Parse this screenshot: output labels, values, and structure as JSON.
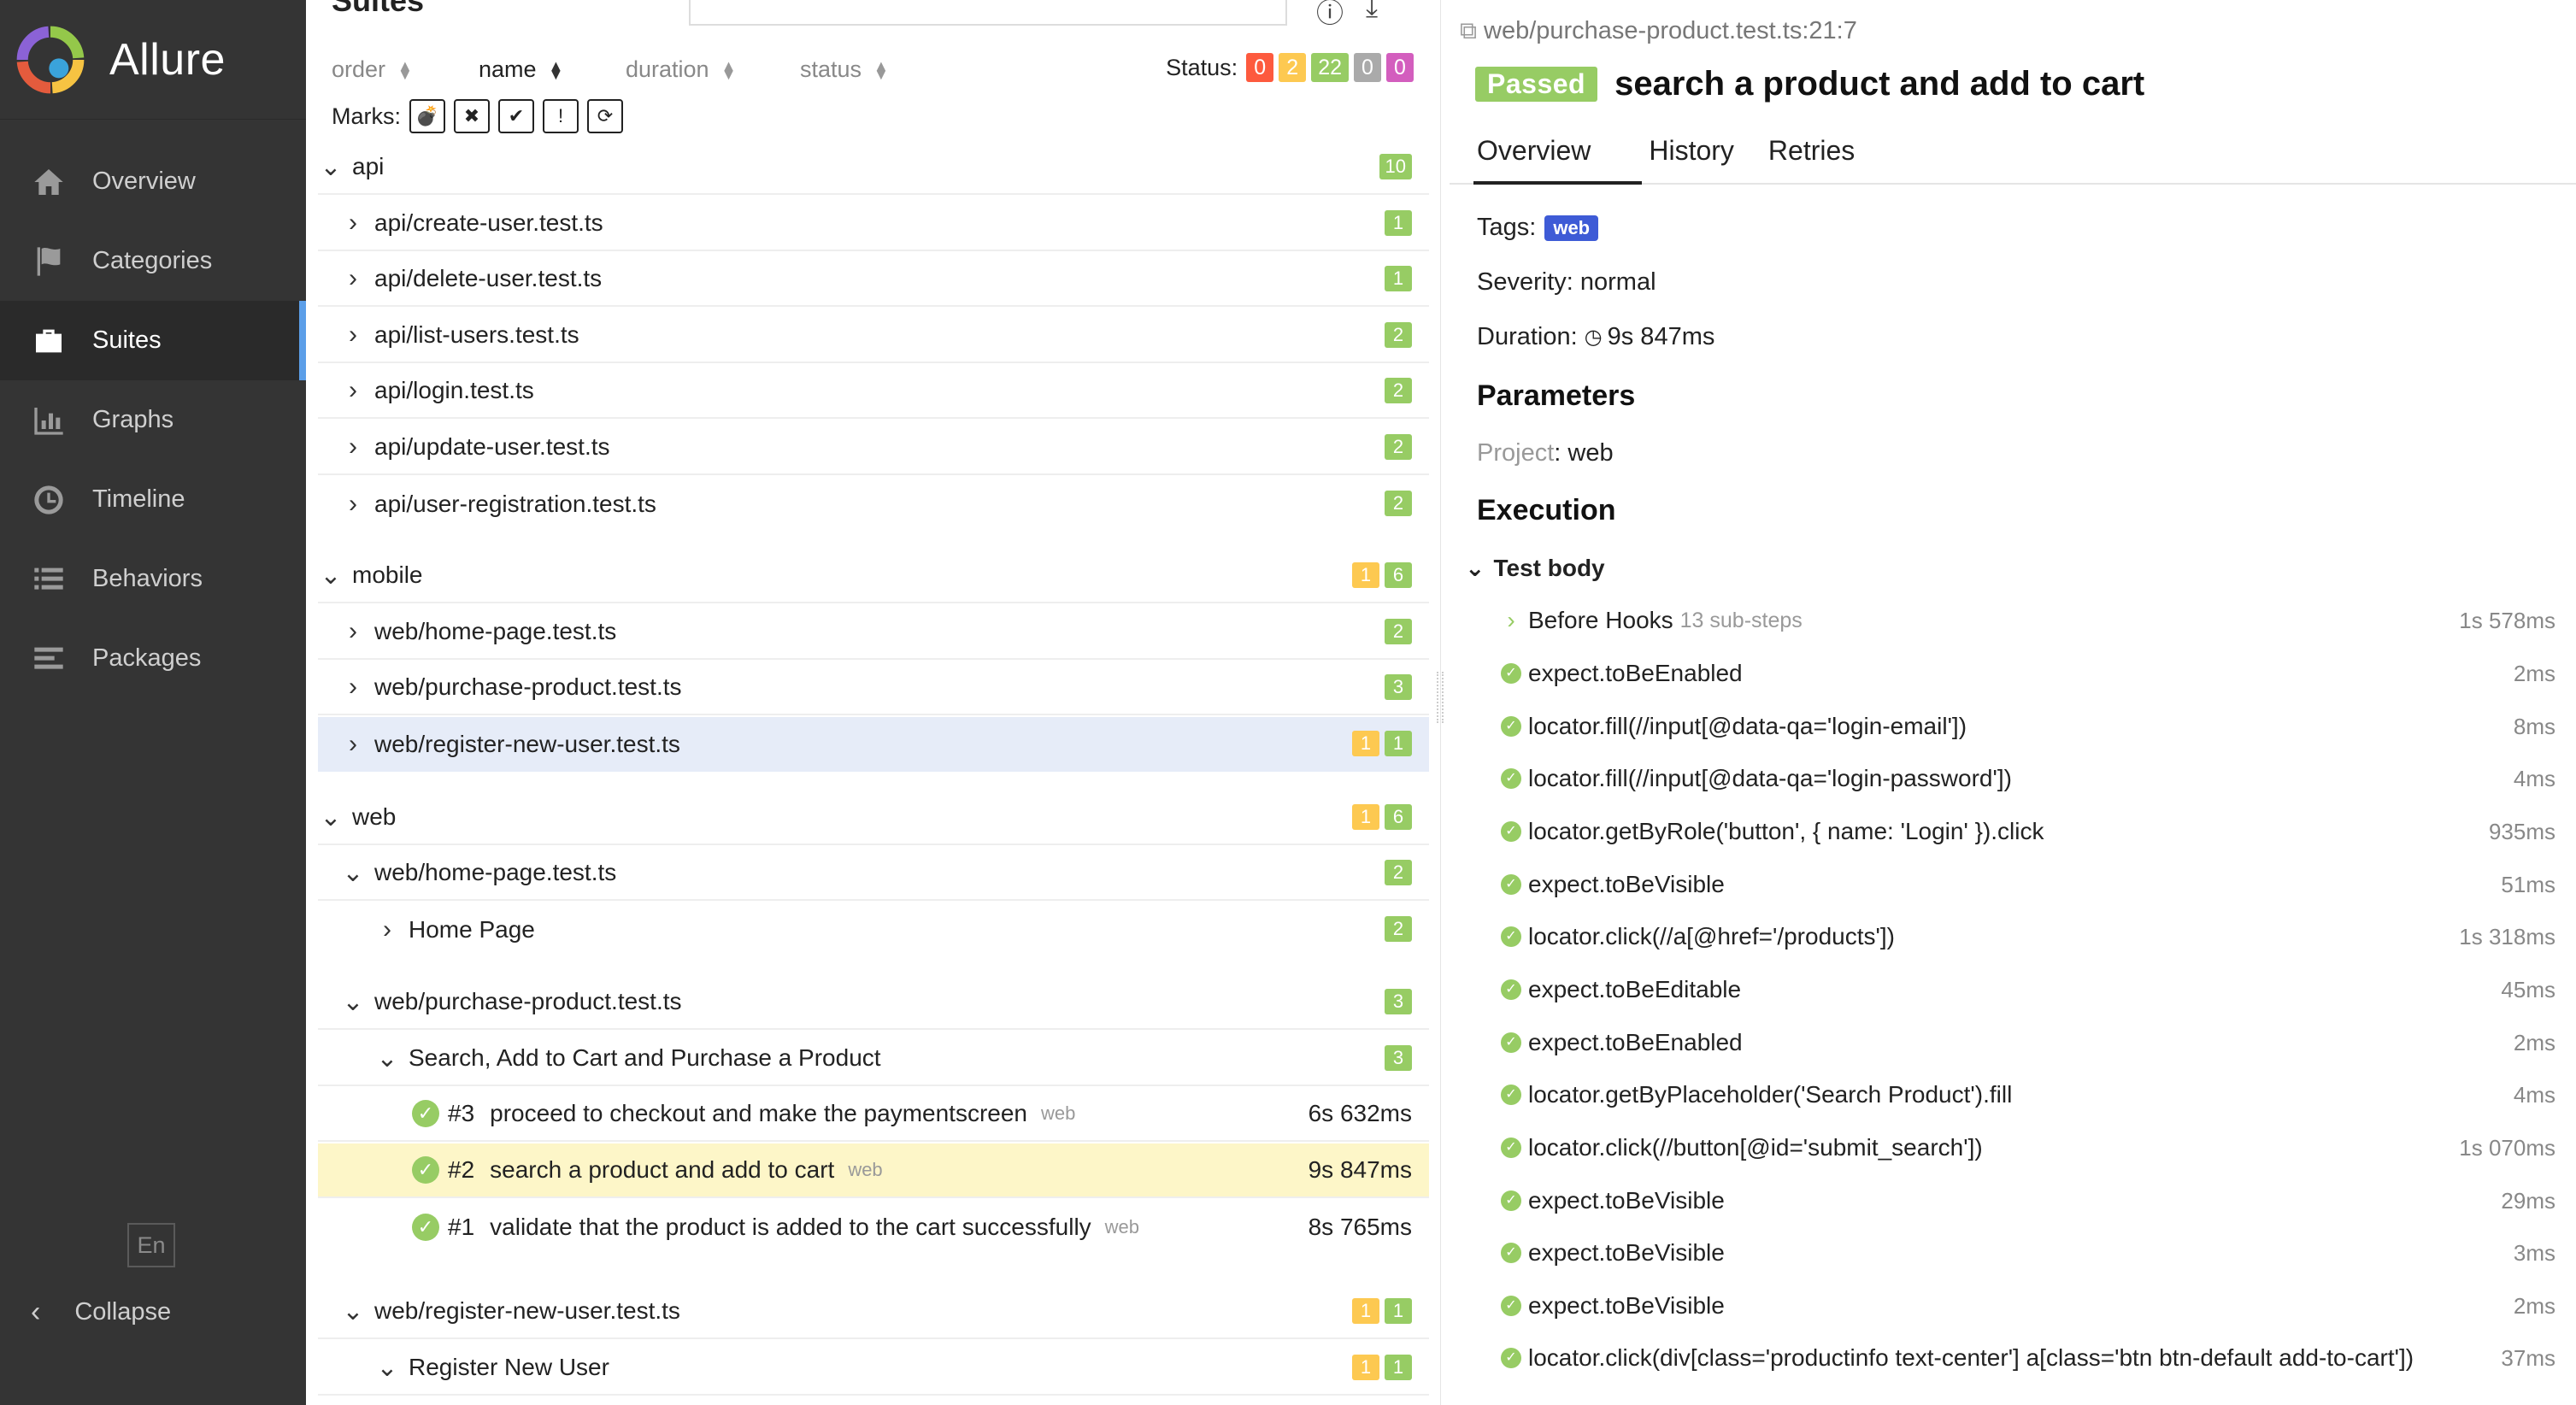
{
  "app": {
    "brand": "Allure",
    "language": "En",
    "collapse_label": "Collapse"
  },
  "sidebar": {
    "items": [
      {
        "label": "Overview",
        "icon": "home-icon"
      },
      {
        "label": "Categories",
        "icon": "flag-icon"
      },
      {
        "label": "Suites",
        "icon": "briefcase-icon",
        "active": true
      },
      {
        "label": "Graphs",
        "icon": "bar-chart-icon"
      },
      {
        "label": "Timeline",
        "icon": "clock-icon"
      },
      {
        "label": "Behaviors",
        "icon": "list-icon"
      },
      {
        "label": "Packages",
        "icon": "align-left-icon"
      }
    ]
  },
  "suites": {
    "heading": "Suites",
    "sort": {
      "order": "order",
      "name": "name",
      "duration": "duration",
      "status": "status"
    },
    "status_label": "Status:",
    "status_counts": {
      "failed": "0",
      "broken": "2",
      "passed": "22",
      "skipped": "0",
      "unknown": "0"
    },
    "marks_label": "Marks:",
    "tree": {
      "api": {
        "label": "api",
        "count": "10"
      },
      "api_items": [
        {
          "label": "api/create-user.test.ts",
          "count": "1"
        },
        {
          "label": "api/delete-user.test.ts",
          "count": "1"
        },
        {
          "label": "api/list-users.test.ts",
          "count": "2"
        },
        {
          "label": "api/login.test.ts",
          "count": "2"
        },
        {
          "label": "api/update-user.test.ts",
          "count": "2"
        },
        {
          "label": "api/user-registration.test.ts",
          "count": "2"
        }
      ],
      "mobile": {
        "label": "mobile",
        "broken": "1",
        "passed": "6"
      },
      "mobile_items": [
        {
          "label": "web/home-page.test.ts",
          "count": "2"
        },
        {
          "label": "web/purchase-product.test.ts",
          "count": "3"
        },
        {
          "label": "web/register-new-user.test.ts",
          "broken": "1",
          "passed": "1"
        }
      ],
      "web": {
        "label": "web",
        "broken": "1",
        "passed": "6"
      },
      "web_home": {
        "label": "web/home-page.test.ts",
        "count": "2"
      },
      "web_home_page": {
        "label": "Home Page",
        "count": "2"
      },
      "web_purchase": {
        "label": "web/purchase-product.test.ts",
        "count": "3"
      },
      "web_purchase_suite": {
        "label": "Search, Add to Cart and Purchase a Product",
        "count": "3"
      },
      "tests": [
        {
          "num": "#3",
          "name": "proceed to checkout and make the paymentscreen",
          "tag": "web",
          "duration": "6s 632ms"
        },
        {
          "num": "#2",
          "name": "search a product and add to cart",
          "tag": "web",
          "duration": "9s 847ms"
        },
        {
          "num": "#1",
          "name": "validate that the product is added to the cart successfully",
          "tag": "web",
          "duration": "8s 765ms"
        }
      ],
      "web_register": {
        "label": "web/register-new-user.test.ts",
        "broken": "1",
        "passed": "1"
      },
      "web_register_suite": {
        "label": "Register New User",
        "broken": "1",
        "passed": "1"
      }
    }
  },
  "detail": {
    "path": "web/purchase-product.test.ts:21:7",
    "status": "Passed",
    "title": "search a product and add to cart",
    "tabs": [
      "Overview",
      "History",
      "Retries"
    ],
    "tags_label": "Tags:",
    "tag": "web",
    "severity": "Severity: normal",
    "duration_label": "Duration:",
    "duration": "9s 847ms",
    "parameters_heading": "Parameters",
    "param_key": "Project",
    "param_value": ": web",
    "execution_heading": "Execution",
    "test_body": "Test body",
    "steps": [
      {
        "name": "Before Hooks",
        "sub": "13 sub-steps",
        "time": "1s 578ms",
        "expandable": true
      },
      {
        "name": "expect.toBeEnabled",
        "time": "2ms"
      },
      {
        "name": "locator.fill(//input[@data-qa='login-email'])",
        "time": "8ms"
      },
      {
        "name": "locator.fill(//input[@data-qa='login-password'])",
        "time": "4ms"
      },
      {
        "name": "locator.getByRole('button', { name: 'Login' }).click",
        "time": "935ms"
      },
      {
        "name": "expect.toBeVisible",
        "time": "51ms"
      },
      {
        "name": "locator.click(//a[@href='/products'])",
        "time": "1s 318ms"
      },
      {
        "name": "expect.toBeEditable",
        "time": "45ms"
      },
      {
        "name": "expect.toBeEnabled",
        "time": "2ms"
      },
      {
        "name": "locator.getByPlaceholder('Search Product').fill",
        "time": "4ms"
      },
      {
        "name": "locator.click(//button[@id='submit_search'])",
        "time": "1s 070ms"
      },
      {
        "name": "expect.toBeVisible",
        "time": "29ms"
      },
      {
        "name": "expect.toBeVisible",
        "time": "3ms"
      },
      {
        "name": "expect.toBeVisible",
        "time": "2ms"
      },
      {
        "name": "locator.click(div[class='productinfo text-center'] a[class='btn btn-default add-to-cart'])",
        "time": "37ms"
      }
    ]
  }
}
